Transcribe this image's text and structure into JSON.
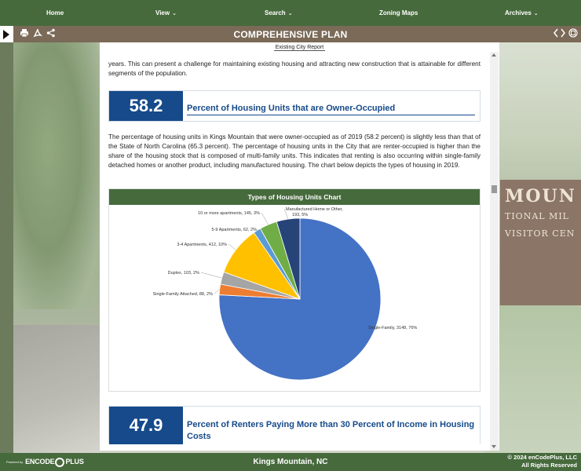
{
  "nav": {
    "home": "Home",
    "view": "View",
    "search": "Search",
    "zoning_maps": "Zoning Maps",
    "archives": "Archives"
  },
  "toolbar": {
    "title": "COMPREHENSIVE PLAN"
  },
  "document": {
    "report_label": "Existing City Report",
    "intro_text": "years. This can present a challenge for maintaining existing housing and attracting new construction that is attainable for different segments of the population.",
    "stat1": {
      "value": "58.2",
      "label": "Percent of Housing Units that are Owner-Occupied"
    },
    "body_text": "The percentage of housing units in Kings Mountain that were owner-occupied as of 2019 (58.2 percent) is slightly less than that of the State of North Carolina (65.3 percent). The percentage of housing units in the City that are renter-occupied is higher than the share of the housing stock that is composed of multi-family units. This indicates that renting is also occurring within single-family detached homes or another product, including manufactured housing. The chart below depicts the types of housing in 2019.",
    "stat2": {
      "value": "47.9",
      "label": "Percent of Renters Paying More than 30 Percent of Income in Housing Costs"
    }
  },
  "chart_data": {
    "type": "pie",
    "title": "Types of Housing Units Chart",
    "slices": [
      {
        "name": "Single-Family",
        "value": 3148,
        "percent": 76,
        "label": "Single-Family, 3148, 76%",
        "color": "#4472c4"
      },
      {
        "name": "Single-Family Attached",
        "value": 88,
        "percent": 2,
        "label": "Single-Family Attached, 88, 2%",
        "color": "#ed7d31"
      },
      {
        "name": "Duplex",
        "value": 103,
        "percent": 2,
        "label": "Duplex, 103, 2%",
        "color": "#a5a5a5"
      },
      {
        "name": "3-4 Apartments",
        "value": 412,
        "percent": 10,
        "label": "3-4 Apartments, 412, 10%",
        "color": "#ffc000"
      },
      {
        "name": "5-9 Apartments",
        "value": 62,
        "percent": 2,
        "label": "5-9 Apartments, 62, 2%",
        "color": "#5b9bd5"
      },
      {
        "name": "10 or more apartments",
        "value": 145,
        "percent": 3,
        "label": "10 or more apartments, 145, 3%",
        "color": "#70ad47"
      },
      {
        "name": "Manufactured Home or Other",
        "value": 193,
        "percent": 5,
        "label": "Manufactured Home or Other, 193, 5%",
        "color": "#264478"
      }
    ]
  },
  "background": {
    "sign_line1": "MOUN",
    "sign_line2": "TIONAL MIL",
    "sign_line3": "VISITOR CEN"
  },
  "footer": {
    "city": "Kings Mountain, NC",
    "copyright": "© 2024 enCodePlus, LLC",
    "rights": "All Rights Reserved",
    "powered": "Powered by",
    "logo_part1": "ENCODE",
    "logo_part2": "PLUS"
  },
  "colors": {
    "nav_green": "#466a3c",
    "toolbar_brown": "#7a6a57",
    "stat_blue": "#164a8a"
  }
}
